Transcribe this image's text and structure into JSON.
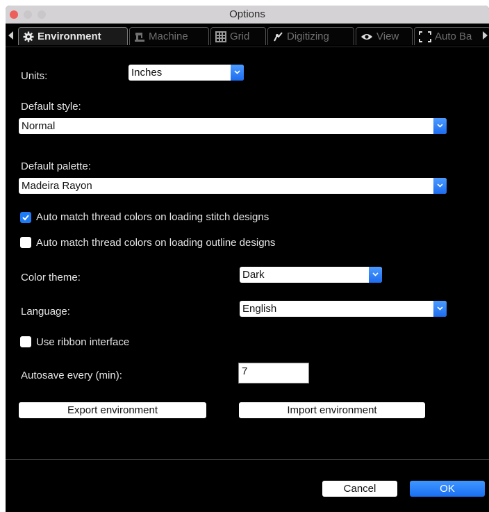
{
  "window": {
    "title": "Options"
  },
  "tabs": [
    {
      "label": "Environment",
      "icon": "gear-icon"
    },
    {
      "label": "Machine",
      "icon": "sewing-machine-icon"
    },
    {
      "label": "Grid",
      "icon": "grid-icon"
    },
    {
      "label": "Digitizing",
      "icon": "digitizing-icon"
    },
    {
      "label": "View",
      "icon": "eye-icon"
    },
    {
      "label": "Auto Ba",
      "icon": "frame-icon"
    }
  ],
  "units": {
    "label": "Units:",
    "value": "Inches"
  },
  "default_style": {
    "label": "Default style:",
    "value": "Normal"
  },
  "default_palette": {
    "label": "Default palette:",
    "value": "Madeira Rayon"
  },
  "auto_match_stitch": {
    "label": "Auto match thread colors on loading stitch designs",
    "checked": true
  },
  "auto_match_outline": {
    "label": "Auto match thread colors on loading outline designs",
    "checked": false
  },
  "color_theme": {
    "label": "Color theme:",
    "value": "Dark"
  },
  "language": {
    "label": "Language:",
    "value": "English"
  },
  "ribbon": {
    "label": "Use ribbon interface",
    "checked": false
  },
  "autosave": {
    "label": "Autosave every (min):",
    "value": "7"
  },
  "buttons": {
    "export": "Export environment",
    "import": "Import environment",
    "cancel": "Cancel",
    "ok": "OK"
  },
  "colors": {
    "accent": "#1d7bf5",
    "background": "#000000",
    "close": "#ec5f5a"
  }
}
